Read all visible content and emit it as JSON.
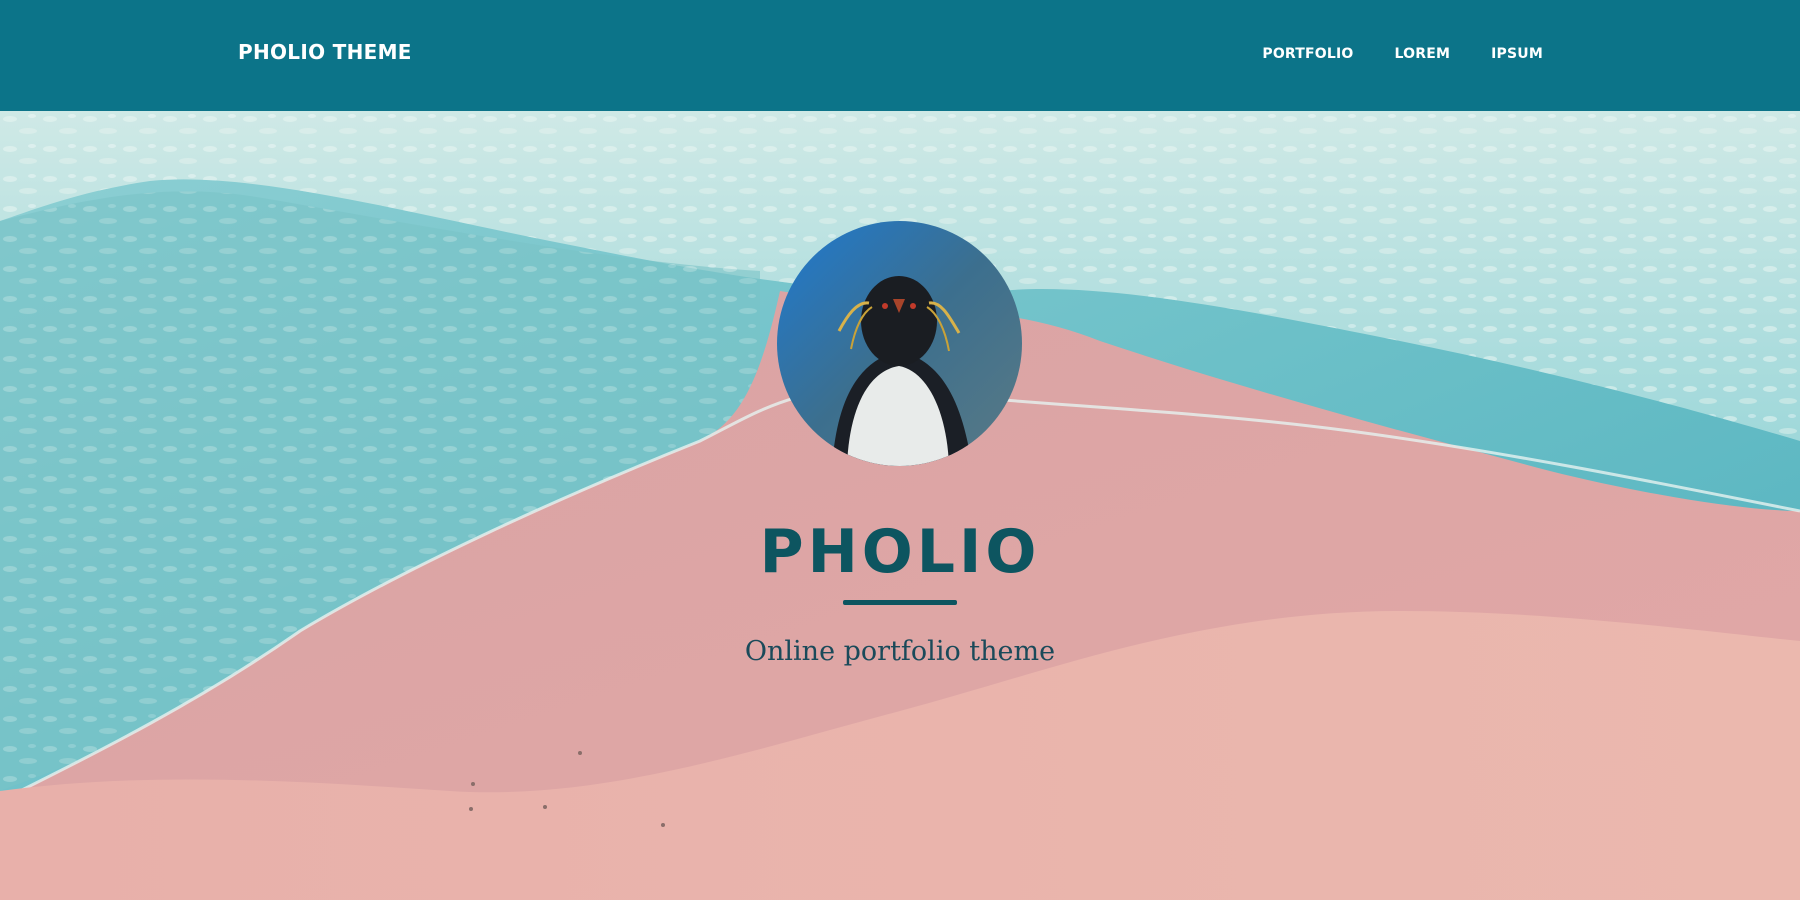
{
  "navbar": {
    "brand": "PHOLIO THEME",
    "links": [
      "PORTFOLIO",
      "LOREM",
      "IPSUM"
    ]
  },
  "hero": {
    "title": "PHOLIO",
    "subtitle": "Online portfolio theme",
    "avatar_subject": "penguin-photo",
    "background_subject": "beach-aerial-photo"
  },
  "colors": {
    "navbar_bg": "#0c7489",
    "title_color": "#0d5560",
    "sand": "#e5aaa5",
    "water": "#5bb7c2"
  }
}
